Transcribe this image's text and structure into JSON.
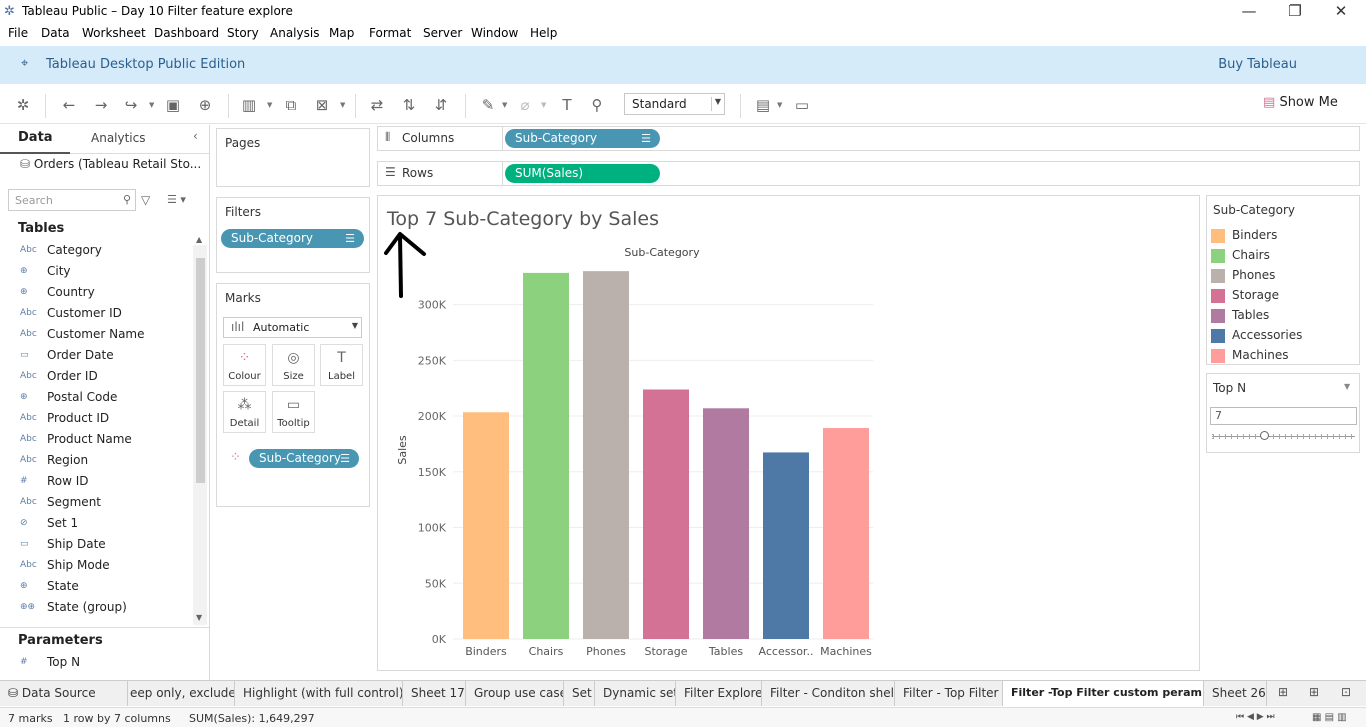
{
  "window": {
    "title": "Tableau Public – Day 10 Filter feature explore"
  },
  "menu": [
    "File",
    "Data",
    "Worksheet",
    "Dashboard",
    "Story",
    "Analysis",
    "Map",
    "Format",
    "Server",
    "Window",
    "Help"
  ],
  "banner": {
    "edition": "Tableau Desktop Public Edition",
    "buy": "Buy Tableau"
  },
  "toolbar": {
    "fit": "Standard",
    "show_me": "Show Me"
  },
  "left_pane": {
    "tab_data": "Data",
    "tab_analytics": "Analytics",
    "datasource": "Orders (Tableau Retail Sto...",
    "search_placeholder": "Search",
    "tables_header": "Tables",
    "parameters_header": "Parameters",
    "fields": [
      {
        "type": "Abc",
        "name": "Category"
      },
      {
        "type": "globe",
        "name": "City"
      },
      {
        "type": "globe",
        "name": "Country"
      },
      {
        "type": "Abc",
        "name": "Customer ID"
      },
      {
        "type": "Abc",
        "name": "Customer Name"
      },
      {
        "type": "date",
        "name": "Order Date"
      },
      {
        "type": "Abc",
        "name": "Order ID"
      },
      {
        "type": "globe",
        "name": "Postal Code"
      },
      {
        "type": "Abc",
        "name": "Product ID"
      },
      {
        "type": "Abc",
        "name": "Product Name"
      },
      {
        "type": "Abc",
        "name": "Region"
      },
      {
        "type": "#",
        "name": "Row ID"
      },
      {
        "type": "Abc",
        "name": "Segment"
      },
      {
        "type": "set",
        "name": "Set 1"
      },
      {
        "type": "date",
        "name": "Ship Date"
      },
      {
        "type": "Abc",
        "name": "Ship Mode"
      },
      {
        "type": "globe",
        "name": "State"
      },
      {
        "type": "group",
        "name": "State (group)"
      }
    ],
    "parameters": [
      {
        "type": "#",
        "name": "Top N"
      }
    ]
  },
  "cards": {
    "pages": "Pages",
    "filters": "Filters",
    "filter_pill": "Sub-Category",
    "marks": "Marks",
    "mark_type": "Automatic",
    "mark_buttons": [
      "Colour",
      "Size",
      "Label",
      "Detail",
      "Tooltip"
    ],
    "marks_pill": "Sub-Category"
  },
  "shelves": {
    "columns_label": "Columns",
    "columns_pill": "Sub-Category",
    "rows_label": "Rows",
    "rows_pill": "SUM(Sales)"
  },
  "view": {
    "title": "Top 7  Sub-Category by Sales"
  },
  "chart_data": {
    "type": "bar",
    "title": "",
    "xlabel": "Sub-Category",
    "ylabel": "Sales",
    "categories": [
      "Binders",
      "Chairs",
      "Phones",
      "Storage",
      "Tables",
      "Accessor..",
      "Machines"
    ],
    "values": [
      203413,
      328449,
      330007,
      223844,
      206966,
      167380,
      189239
    ],
    "colors": [
      "#ffbe7d",
      "#8cd17d",
      "#bab0ac",
      "#d37295",
      "#b07aa1",
      "#4e79a7",
      "#ff9d9a"
    ],
    "yticks": [
      "0K",
      "50K",
      "100K",
      "150K",
      "200K",
      "250K",
      "300K"
    ],
    "ylim": [
      0,
      340000
    ]
  },
  "legend": {
    "title": "Sub-Category",
    "items": [
      {
        "label": "Binders",
        "color": "#ffbe7d"
      },
      {
        "label": "Chairs",
        "color": "#8cd17d"
      },
      {
        "label": "Phones",
        "color": "#bab0ac"
      },
      {
        "label": "Storage",
        "color": "#d37295"
      },
      {
        "label": "Tables",
        "color": "#b07aa1"
      },
      {
        "label": "Accessories",
        "color": "#4e79a7"
      },
      {
        "label": "Machines",
        "color": "#ff9d9a"
      }
    ]
  },
  "topn": {
    "title": "Top N",
    "value": "7",
    "slider_fraction": 0.37
  },
  "bottom_tabs": {
    "data_source": "Data Source",
    "tabs": [
      "eep only, exclude",
      "Highlight (with full control)",
      "Sheet 17",
      "Group use case",
      "Set",
      "Dynamic set",
      "Filter Explore",
      "Filter - Conditon shelf",
      "Filter - Top Filter",
      "Filter -Top Filter custom peram...",
      "Sheet 26"
    ]
  },
  "status": {
    "marks": "7 marks",
    "rows": "1 row  by  7 columns",
    "sum": "SUM(Sales): 1,649,297"
  }
}
